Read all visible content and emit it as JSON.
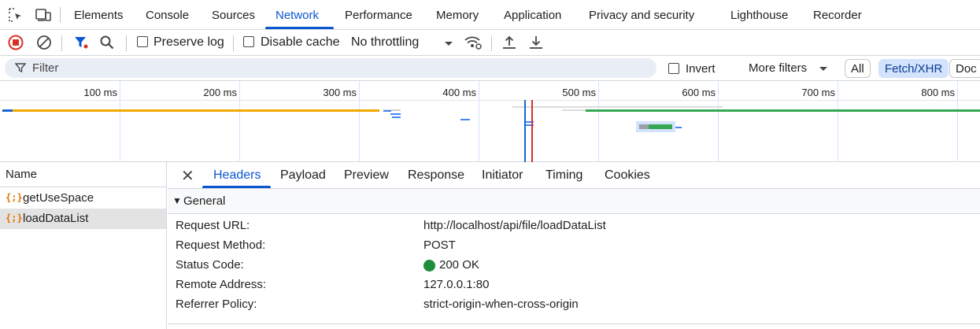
{
  "tabs": [
    "Elements",
    "Console",
    "Sources",
    "Network",
    "Performance",
    "Memory",
    "Application",
    "Privacy and security",
    "Lighthouse",
    "Recorder"
  ],
  "active_tab": "Network",
  "toolbar": {
    "preserve_log": "Preserve log",
    "disable_cache": "Disable cache",
    "throttling": "No throttling"
  },
  "filter": {
    "placeholder": "Filter",
    "invert": "Invert",
    "more_filters": "More filters",
    "chips": [
      "All",
      "Fetch/XHR",
      "Doc"
    ],
    "selected_chip": "Fetch/XHR"
  },
  "timeline": {
    "ticks": [
      "100 ms",
      "200 ms",
      "300 ms",
      "400 ms",
      "500 ms",
      "600 ms",
      "700 ms",
      "800 ms"
    ]
  },
  "requests": {
    "header": "Name",
    "items": [
      "getUseSpace",
      "loadDataList"
    ],
    "selected": "loadDataList"
  },
  "detail": {
    "tabs": [
      "Headers",
      "Payload",
      "Preview",
      "Response",
      "Initiator",
      "Timing",
      "Cookies"
    ],
    "active_tab": "Headers",
    "section": "General",
    "rows": [
      {
        "key": "Request URL:",
        "value": "http://localhost/api/file/loadDataList"
      },
      {
        "key": "Request Method:",
        "value": "POST"
      },
      {
        "key": "Status Code:",
        "value": "200 OK"
      },
      {
        "key": "Remote Address:",
        "value": "127.0.0.1:80"
      },
      {
        "key": "Referrer Policy:",
        "value": "strict-origin-when-cross-origin"
      }
    ]
  },
  "colors": {
    "accent": "#0b57d0",
    "record_red": "#d93025",
    "status_green": "#1e8e3e",
    "bar_orange": "#f2a900",
    "bar_green": "#34a853",
    "bar_blue": "#4285f4",
    "xhr_icon": "#e37400"
  },
  "icons": {
    "inspect": "element-picker-icon",
    "device": "device-toolbar-icon",
    "record": "record-stop-icon",
    "clear": "clear-icon",
    "filter": "filter-icon",
    "search": "search-icon",
    "wifi": "network-conditions-icon",
    "upload": "import-har-icon",
    "download": "export-har-icon"
  }
}
